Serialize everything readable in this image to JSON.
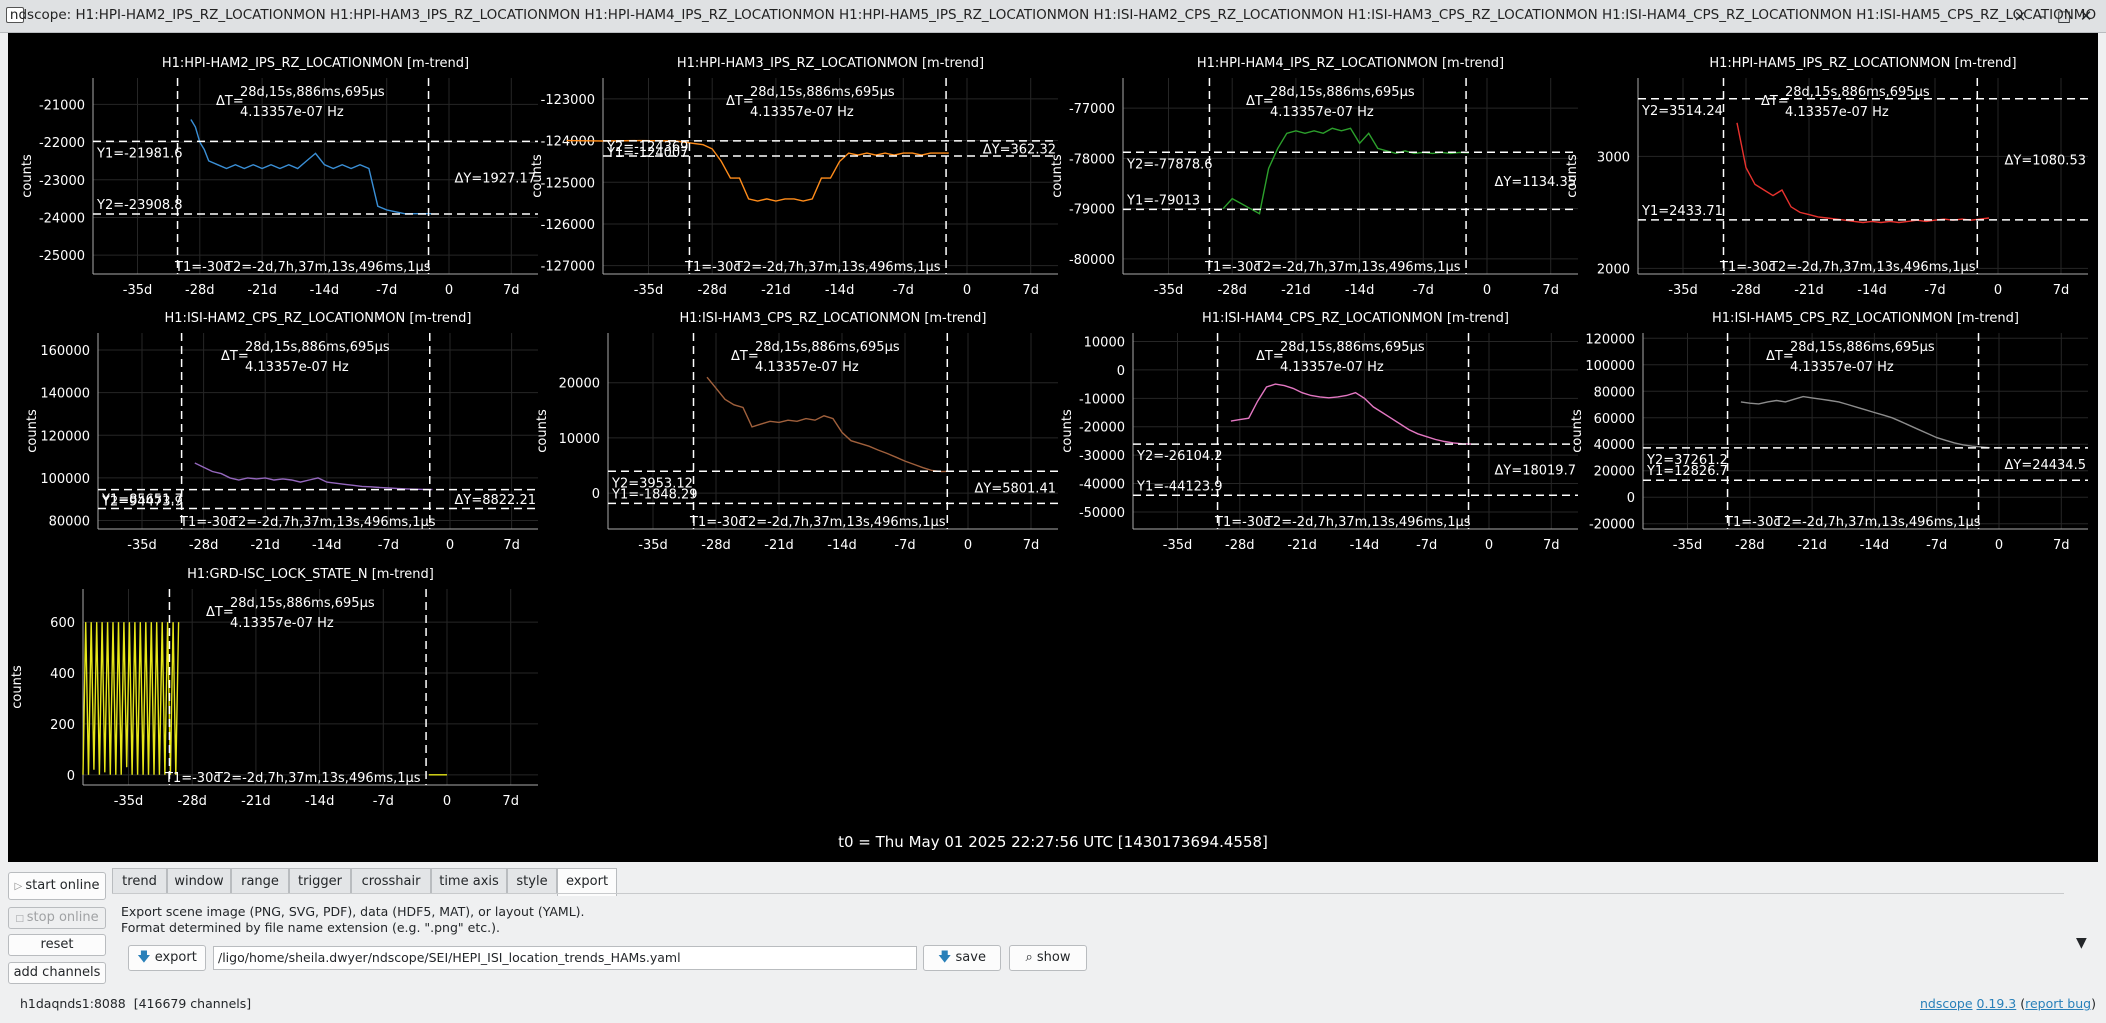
{
  "window": {
    "title": "ndscope: H1:HPI-HAM2_IPS_RZ_LOCATIONMON H1:HPI-HAM3_IPS_RZ_LOCATIONMON H1:HPI-HAM4_IPS_RZ_LOCATIONMON H1:HPI-HAM5_IPS_RZ_LOCATIONMON H1:ISI-HAM2_CPS_RZ_LOCATIONMON H1:ISI-HAM3_CPS_RZ_LOCATIONMON H1:ISI-HAM4_CPS_RZ_LOCATIONMON H1:ISI-HAM5_CPS_RZ_LOCATIONMO",
    "buttons": [
      "×",
      "–",
      "□",
      "✕"
    ]
  },
  "common": {
    "ylabel": "counts",
    "dt_label": "ΔT=",
    "dt_value": "28d,15s,886ms,695µs",
    "freq": "4.13357e-07 Hz",
    "t1": "T1=-30c",
    "t2": "T2=-2d,7h,37m,13s,496ms,1µs",
    "xticks": [
      "-35d",
      "-28d",
      "-21d",
      "-14d",
      "-7d",
      "0",
      "7d"
    ]
  },
  "t0_label": "t0 = Thu May 01 2025 22:27:56 UTC [1430173694.4558]",
  "chart_data": [
    {
      "type": "line",
      "title": "H1:HPI-HAM2_IPS_RZ_LOCATIONMON [m-trend]",
      "ylabel": "counts",
      "yticks": [
        "-21000",
        "-22000",
        "-23000",
        "-24000",
        "-25000"
      ],
      "ylim": [
        -25500,
        -20300
      ],
      "color": "#3a8fd6",
      "y1": "Y1=-21981.6",
      "y2": "Y2=-23908.8",
      "dy": "ΔY=1927.17",
      "y1v": -21981.6,
      "y2v": -23908.8,
      "series": [
        {
          "x": [
            -29,
            -28.5,
            -28,
            -27.5,
            -27,
            -26,
            -25,
            -24,
            -23,
            -22,
            -21,
            -20,
            -19,
            -18,
            -17,
            -16,
            -15,
            -14,
            -13,
            -12,
            -11,
            -10,
            -9,
            -8,
            -7,
            -6,
            -5,
            -4,
            -3,
            -2
          ],
          "y": [
            -21400,
            -21600,
            -22000,
            -22200,
            -22500,
            -22600,
            -22700,
            -22600,
            -22700,
            -22600,
            -22700,
            -22600,
            -22700,
            -22600,
            -22700,
            -22500,
            -22300,
            -22600,
            -22700,
            -22600,
            -22700,
            -22600,
            -22700,
            -23700,
            -23800,
            -23850,
            -23900,
            -23900,
            -23900,
            -23900
          ]
        }
      ]
    },
    {
      "type": "line",
      "title": "H1:HPI-HAM3_IPS_RZ_LOCATIONMON [m-trend]",
      "ylabel": "counts",
      "yticks": [
        "-123000",
        "-124000",
        "-125000",
        "-126000",
        "-127000"
      ],
      "ylim": [
        -127200,
        -122500
      ],
      "color": "#ff8c1a",
      "y1": "Y1=-124007",
      "y2": "Y2=-124369",
      "dy": "ΔY=362.32",
      "y1v": -124007,
      "y2v": -124369,
      "series": [
        {
          "x": [
            -44,
            -40,
            -36,
            -32,
            -29,
            -28,
            -27,
            -26,
            -25,
            -24,
            -23,
            -22,
            -21,
            -20,
            -19,
            -18,
            -17,
            -16,
            -15,
            -14,
            -13,
            -12,
            -11,
            -10,
            -9,
            -8,
            -7,
            -6,
            -5,
            -4,
            -3,
            -2
          ],
          "y": [
            -124000,
            -124010,
            -124000,
            -124010,
            -124100,
            -124200,
            -124500,
            -124900,
            -124900,
            -125400,
            -125450,
            -125400,
            -125450,
            -125400,
            -125400,
            -125450,
            -125400,
            -124900,
            -124900,
            -124500,
            -124300,
            -124350,
            -124300,
            -124350,
            -124300,
            -124350,
            -124300,
            -124300,
            -124350,
            -124300,
            -124300,
            -124300
          ]
        }
      ]
    },
    {
      "type": "line",
      "title": "H1:HPI-HAM4_IPS_RZ_LOCATIONMON [m-trend]",
      "ylabel": "counts",
      "yticks": [
        "-77000",
        "-78000",
        "-79000",
        "-80000"
      ],
      "ylim": [
        -80300,
        -76400
      ],
      "color": "#2ca02c",
      "y1": "Y1=-79013",
      "y2": "Y2=-77878.6",
      "dy": "ΔY=1134.35",
      "y1v": -79013,
      "y2v": -77878.6,
      "series": [
        {
          "x": [
            -29,
            -28,
            -27,
            -26,
            -25,
            -24,
            -23,
            -22,
            -21,
            -20,
            -19,
            -18,
            -17,
            -16,
            -15,
            -14,
            -13,
            -12,
            -11,
            -10,
            -9,
            -8,
            -7,
            -6,
            -5,
            -4,
            -3,
            -2
          ],
          "y": [
            -79000,
            -78800,
            -78900,
            -79000,
            -79100,
            -78200,
            -77800,
            -77500,
            -77450,
            -77500,
            -77450,
            -77500,
            -77400,
            -77450,
            -77400,
            -77700,
            -77500,
            -77800,
            -77850,
            -77900,
            -77850,
            -77900,
            -77880,
            -77900,
            -77880,
            -77900,
            -77880,
            -77890
          ]
        }
      ]
    },
    {
      "type": "line",
      "title": "H1:HPI-HAM5_IPS_RZ_LOCATIONMON [m-trend]",
      "ylabel": "counts",
      "yticks": [
        "3000",
        "2000"
      ],
      "ylim": [
        1950,
        3700
      ],
      "color": "#e8322e",
      "y1": "Y1=2433.71",
      "y2": "Y2=3514.24",
      "dy": "ΔY=1080.53",
      "y1v": 2433.71,
      "y2v": 3514.24,
      "series": [
        {
          "x": [
            -29,
            -28.5,
            -28,
            -27,
            -26,
            -25,
            -24,
            -23,
            -22,
            -21,
            -20,
            -19,
            -18,
            -17,
            -16,
            -15,
            -14,
            -13,
            -12,
            -11,
            -10,
            -9,
            -8,
            -7,
            -6,
            -5,
            -4,
            -3,
            -2,
            -1
          ],
          "y": [
            3300,
            3100,
            2900,
            2750,
            2700,
            2650,
            2700,
            2550,
            2500,
            2480,
            2460,
            2450,
            2440,
            2430,
            2420,
            2410,
            2420,
            2410,
            2420,
            2410,
            2420,
            2430,
            2420,
            2430,
            2440,
            2430,
            2440,
            2430,
            2440,
            2450
          ]
        }
      ]
    },
    {
      "type": "line",
      "title": "H1:ISI-HAM2_CPS_RZ_LOCATIONMON [m-trend]",
      "ylabel": "counts",
      "yticks": [
        "160000",
        "140000",
        "120000",
        "100000",
        "80000"
      ],
      "ylim": [
        76000,
        168000
      ],
      "color": "#9467bd",
      "y1": "Y1=85651.7",
      "y2": "Y2=94473.9",
      "dy": "ΔY=8822.21",
      "y1v": 85651.7,
      "y2v": 94473.9,
      "series": [
        {
          "x": [
            -29,
            -28,
            -27,
            -26,
            -25,
            -24,
            -23,
            -22,
            -21,
            -20,
            -19,
            -18,
            -17,
            -16,
            -15,
            -14,
            -13,
            -12,
            -11,
            -10,
            -9,
            -8,
            -7,
            -6,
            -5,
            -4,
            -3,
            -2
          ],
          "y": [
            107000,
            105000,
            103000,
            102000,
            100000,
            99000,
            100000,
            99500,
            100000,
            99000,
            99500,
            99000,
            98000,
            99000,
            100000,
            98000,
            97500,
            97000,
            96500,
            96000,
            95800,
            95500,
            95300,
            95000,
            94800,
            94700,
            94600,
            94500
          ]
        }
      ]
    },
    {
      "type": "line",
      "title": "H1:ISI-HAM3_CPS_RZ_LOCATIONMON [m-trend]",
      "ylabel": "counts",
      "yticks": [
        "20000",
        "10000",
        "0"
      ],
      "ylim": [
        -6500,
        29000
      ],
      "color": "#a0603c",
      "y1": "Y1=-1848.29",
      "y2": "Y2=3953.12",
      "dy": "ΔY=5801.41",
      "y1v": -1848.29,
      "y2v": 3953.12,
      "series": [
        {
          "x": [
            -29,
            -28,
            -27,
            -26,
            -25,
            -24,
            -23,
            -22,
            -21,
            -20,
            -19,
            -18,
            -17,
            -16,
            -15,
            -14,
            -13,
            -12,
            -11,
            -10,
            -9,
            -8,
            -7,
            -6,
            -5,
            -4,
            -3,
            -2
          ],
          "y": [
            21000,
            19000,
            17000,
            16000,
            15500,
            12000,
            12500,
            13000,
            12800,
            13200,
            13000,
            13500,
            13200,
            14000,
            13500,
            11000,
            9500,
            9000,
            8500,
            7800,
            7200,
            6500,
            5800,
            5200,
            4600,
            4100,
            3900,
            3950
          ]
        }
      ]
    },
    {
      "type": "line",
      "title": "H1:ISI-HAM4_CPS_RZ_LOCATIONMON [m-trend]",
      "ylabel": "counts",
      "yticks": [
        "10000",
        "0",
        "-10000",
        "-20000",
        "-30000",
        "-40000",
        "-50000"
      ],
      "ylim": [
        -56000,
        13000
      ],
      "color": "#e377c2",
      "y1": "Y1=-44123.9",
      "y2": "Y2=-26104.2",
      "dy": "ΔY=18019.7",
      "y1v": -44123.9,
      "y2v": -26104.2,
      "series": [
        {
          "x": [
            -29,
            -28,
            -27,
            -26,
            -25,
            -24,
            -23,
            -22,
            -21,
            -20,
            -19,
            -18,
            -17,
            -16,
            -15,
            -14,
            -13,
            -12,
            -11,
            -10,
            -9,
            -8,
            -7,
            -6,
            -5,
            -4,
            -3,
            -2
          ],
          "y": [
            -18000,
            -17500,
            -17000,
            -11000,
            -6000,
            -5000,
            -5500,
            -6500,
            -8000,
            -9000,
            -9500,
            -9800,
            -9500,
            -9000,
            -8000,
            -10000,
            -13000,
            -15000,
            -17000,
            -19000,
            -21000,
            -22500,
            -23500,
            -24500,
            -25200,
            -25700,
            -26000,
            -26100
          ]
        }
      ]
    },
    {
      "type": "line",
      "title": "H1:ISI-HAM5_CPS_RZ_LOCATIONMON [m-trend]",
      "ylabel": "counts",
      "yticks": [
        "120000",
        "100000",
        "80000",
        "60000",
        "40000",
        "20000",
        "0",
        "-20000"
      ],
      "ylim": [
        -24000,
        124000
      ],
      "color": "#8c8c8c",
      "y1": "Y1=12826.7",
      "y2": "Y2=37261.2",
      "dy": "ΔY=24434.5",
      "y1v": 12826.7,
      "y2v": 37261.2,
      "series": [
        {
          "x": [
            -29,
            -28,
            -27,
            -26,
            -25,
            -24,
            -23,
            -22,
            -21,
            -20,
            -19,
            -18,
            -17,
            -16,
            -15,
            -14,
            -13,
            -12,
            -11,
            -10,
            -9,
            -8,
            -7,
            -6,
            -5,
            -4,
            -3,
            -2,
            -1
          ],
          "y": [
            72000,
            71000,
            70500,
            72000,
            73000,
            72000,
            74000,
            76000,
            75000,
            74000,
            73000,
            72000,
            70000,
            68000,
            66000,
            64000,
            62000,
            60000,
            57000,
            54000,
            51000,
            48000,
            45000,
            43000,
            41000,
            39500,
            38500,
            38000,
            37300
          ]
        }
      ]
    },
    {
      "type": "line",
      "title": "H1:GRD-ISC_LOCK_STATE_N [m-trend]",
      "ylabel": "counts",
      "yticks": [
        "600",
        "400",
        "200",
        "0"
      ],
      "ylim": [
        -40,
        730
      ],
      "color": "#e6e619",
      "dt_only": true,
      "series": [
        {
          "x": [
            -40,
            -39.7,
            -39.4,
            -39.1,
            -38.8,
            -38.5,
            -38.2,
            -37.9,
            -37.6,
            -37.3,
            -37,
            -36.7,
            -36.4,
            -36.1,
            -35.8,
            -35.5,
            -35.2,
            -34.9,
            -34.6,
            -34.3,
            -34,
            -33.7,
            -33.4,
            -33.1,
            -32.8,
            -32.5,
            -32.2,
            -31.9,
            -31.6,
            -31.3,
            -31,
            -30.7,
            -30.4,
            -30.1,
            -29.8,
            -29.5
          ],
          "y": [
            0,
            600,
            0,
            600,
            20,
            600,
            0,
            600,
            10,
            600,
            0,
            600,
            0,
            600,
            0,
            600,
            30,
            600,
            0,
            600,
            0,
            600,
            0,
            600,
            0,
            600,
            0,
            600,
            0,
            600,
            0,
            600,
            0,
            600,
            0,
            600
          ]
        },
        {
          "x": [
            -2,
            0
          ],
          "y": [
            0,
            0
          ]
        }
      ]
    }
  ],
  "controls": {
    "start_online": "start online",
    "stop_online": "stop online",
    "reset": "reset",
    "add_channels": "add channels"
  },
  "tabs": [
    "trend",
    "window",
    "range",
    "trigger",
    "crosshair",
    "time axis",
    "style",
    "export"
  ],
  "export_panel": {
    "desc1": "Export scene image (PNG, SVG, PDF), data (HDF5, MAT), or layout (YAML).",
    "desc2": "Format determined by file name extension (e.g. \".png\" etc.).",
    "export_button": "export",
    "path": "/ligo/home/sheila.dwyer/ndscope/SEI/HEPI_ISI_location_trends_HAMs.yaml",
    "save_button": "save",
    "show_button": "show"
  },
  "status": {
    "server": "h1daqnds1:8088",
    "channels": "[416679 channels]",
    "app_link": "ndscope",
    "version_link": "0.19.3",
    "report_link": "report bug"
  }
}
